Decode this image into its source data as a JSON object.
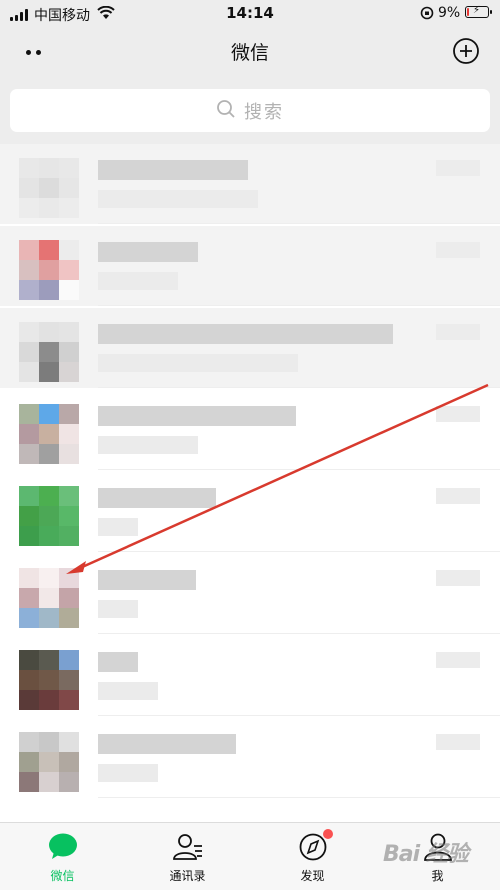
{
  "status_bar": {
    "carrier": "中国移动",
    "time": "14:14",
    "battery_percent": "9%",
    "battery_level": 0.09,
    "icons": [
      "signal-icon",
      "wifi-icon",
      "orientation-lock-icon",
      "battery-charging-icon"
    ]
  },
  "nav": {
    "title": "微信",
    "left_icon": "more-dots-icon",
    "right_icon": "add-circle-icon"
  },
  "search": {
    "placeholder": "搜索",
    "icon": "search-icon"
  },
  "chats": [
    {
      "pinned": true,
      "avatar": [
        "#e8e8e8",
        "#e6e6e6",
        "#e8e8e8",
        "#e4e4e4",
        "#dcdcdc",
        "#e6e6e6",
        "#ececec",
        "#e9e9e9",
        "#ececec"
      ],
      "name_width": 150,
      "msg_width": 160
    },
    {
      "pinned": true,
      "avatar": [
        "#e9b5b5",
        "#e57373",
        "#ececec",
        "#d8c0c0",
        "#e0a0a0",
        "#f0c4c4",
        "#b0b0cc",
        "#9c9cbc",
        "#fafafa"
      ],
      "name_width": 100,
      "msg_width": 80
    },
    {
      "pinned": true,
      "avatar": [
        "#e8e8e8",
        "#e2e2e2",
        "#e4e4e4",
        "#d9d9d9",
        "#8c8c8c",
        "#d0d0d0",
        "#e4e4e4",
        "#7c7c7c",
        "#d8d4d4"
      ],
      "name_width": 295,
      "msg_width": 200
    },
    {
      "pinned": false,
      "avatar": [
        "#a8b49c",
        "#5ea8e8",
        "#b9a8a8",
        "#b49aa0",
        "#c8b0a0",
        "#f0e4e4",
        "#c0b8b8",
        "#a0a0a0",
        "#e8e0e0"
      ],
      "name_width": 198,
      "msg_width": 100
    },
    {
      "pinned": false,
      "avatar": [
        "#5cb870",
        "#4caf50",
        "#6abf7a",
        "#43a047",
        "#4ca856",
        "#58b868",
        "#3d9e4c",
        "#49ab5a",
        "#52b062"
      ],
      "name_width": 118,
      "msg_width": 40
    },
    {
      "pinned": false,
      "avatar": [
        "#f0e4e4",
        "#f8f0f0",
        "#e8d8dc",
        "#c8a8ac",
        "#f2e8e8",
        "#c4a4a8",
        "#8cb0d8",
        "#a0b8c8",
        "#b0ac98"
      ],
      "name_width": 98,
      "msg_width": 40
    },
    {
      "pinned": false,
      "avatar": [
        "#4a4a40",
        "#5a5a50",
        "#7aa0d0",
        "#6a5040",
        "#705848",
        "#7a6a60",
        "#5a3a38",
        "#6a3c3c",
        "#804848"
      ],
      "name_width": 40,
      "msg_width": 60
    },
    {
      "pinned": false,
      "avatar": [
        "#d0d0d0",
        "#c8c8c8",
        "#e0e0e0",
        "#a0a090",
        "#c8c0b8",
        "#b0a8a0",
        "#8c7878",
        "#d8d0d0",
        "#b8b0b0"
      ],
      "name_width": 138,
      "msg_width": 60
    }
  ],
  "tabs": [
    {
      "label": "微信",
      "icon": "chat-bubble-icon",
      "active": true
    },
    {
      "label": "通讯录",
      "icon": "contacts-icon",
      "active": false
    },
    {
      "label": "发现",
      "icon": "compass-icon",
      "active": false,
      "badge": true
    },
    {
      "label": "我",
      "icon": "person-icon",
      "active": false
    }
  ],
  "watermark": "Bai 经验",
  "colors": {
    "accent": "#07c160",
    "badge": "#fa5151",
    "arrow": "#d83a2e"
  }
}
